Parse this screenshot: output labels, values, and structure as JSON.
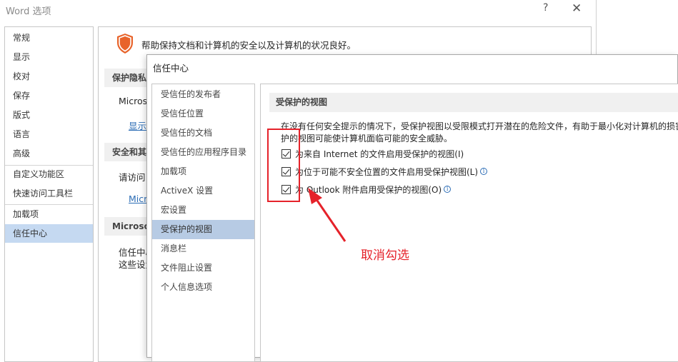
{
  "word_options": {
    "title": "Word 选项",
    "help": "?",
    "close": "✕",
    "nav": [
      "常规",
      "显示",
      "校对",
      "保存",
      "版式",
      "语言",
      "高级",
      "自定义功能区",
      "快速访问工具栏",
      "加载项",
      "信任中心"
    ],
    "active_nav": "信任中心",
    "intro": "帮助保持文档和计算机的安全以及计算机的状况良好。",
    "section1_head": "保护隐私",
    "section1_text": "Micros",
    "section1_link": "显示",
    "section2_head": "安全和其",
    "section2_text": "请访问",
    "section2_link": "Micr",
    "section3_head": "Microso",
    "section3_text1": "信任中心",
    "section3_text2": "这些设置"
  },
  "trust_center": {
    "title": "信任中心",
    "nav": [
      "受信任的发布者",
      "受信任位置",
      "受信任的文档",
      "受信任的应用程序目录",
      "加载项",
      "ActiveX 设置",
      "宏设置",
      "受保护的视图",
      "消息栏",
      "文件阻止设置",
      "个人信息选项"
    ],
    "active_nav": "受保护的视图",
    "section_title": "受保护的视图",
    "desc_line1": "在没有任何安全提示的情况下，受保护视图以受限模式打开潜在的危险文件，有助于最小化对计算机的损害",
    "desc_line2": "护的视图可能使计算机面临可能的安全威胁。",
    "options": [
      {
        "label": "为来自 Internet 的文件启用受保护的视图(I)",
        "checked": true,
        "info": false
      },
      {
        "label": "为位于可能不安全位置的文件启用受保护视图(L)",
        "checked": true,
        "info": true
      },
      {
        "label": "为 Outlook 附件启用受保护的视图(O)",
        "checked": true,
        "info": true
      }
    ]
  },
  "annotation": {
    "text": "取消勾选",
    "color": "#e5222a"
  }
}
